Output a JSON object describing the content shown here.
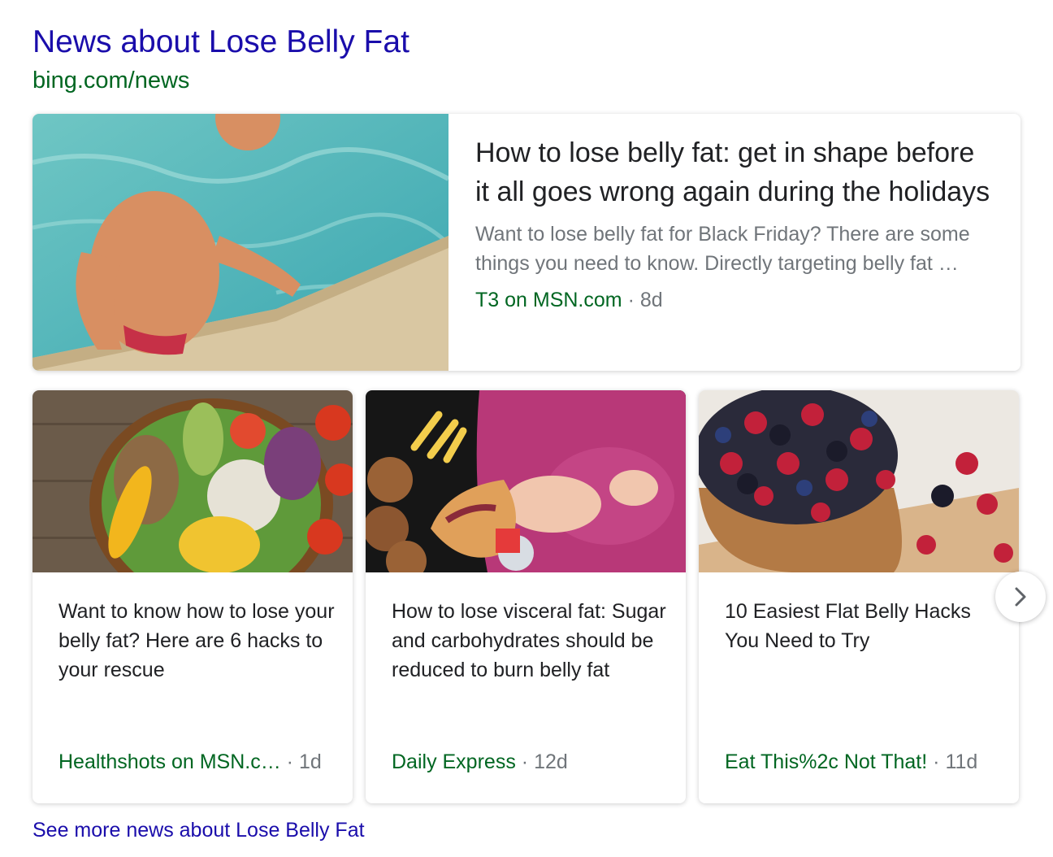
{
  "header": {
    "title": "News about Lose Belly Fat",
    "url": "bing.com/news"
  },
  "featured": {
    "title": "How to lose belly fat: get in shape before it all goes wrong again during the holidays",
    "snippet": "Want to lose belly fat for Black Friday? There are some things you need to know. Directly targeting belly fat …",
    "source": "T3 on MSN.com",
    "separator": "·",
    "age": "8d"
  },
  "cards": [
    {
      "title": "Want to know how to lose your belly fat? Here are 6 hacks to your rescue",
      "source": "Healthshots on MSN.c…",
      "separator": "·",
      "age": "1d"
    },
    {
      "title": "How to lose visceral fat: Sugar and carbohydrates should be reduced to burn belly fat",
      "source": "Daily Express",
      "separator": "·",
      "age": "12d"
    },
    {
      "title": "10 Easiest Flat Belly Hacks You Need to Try",
      "source": "Eat This%2c Not That!",
      "separator": "·",
      "age": "11d"
    }
  ],
  "see_more": "See more news about Lose Belly Fat",
  "icons": {
    "next": "chevron-right-icon"
  },
  "colors": {
    "link": "#1a0dab",
    "url_green": "#006621",
    "muted": "#70757a"
  }
}
